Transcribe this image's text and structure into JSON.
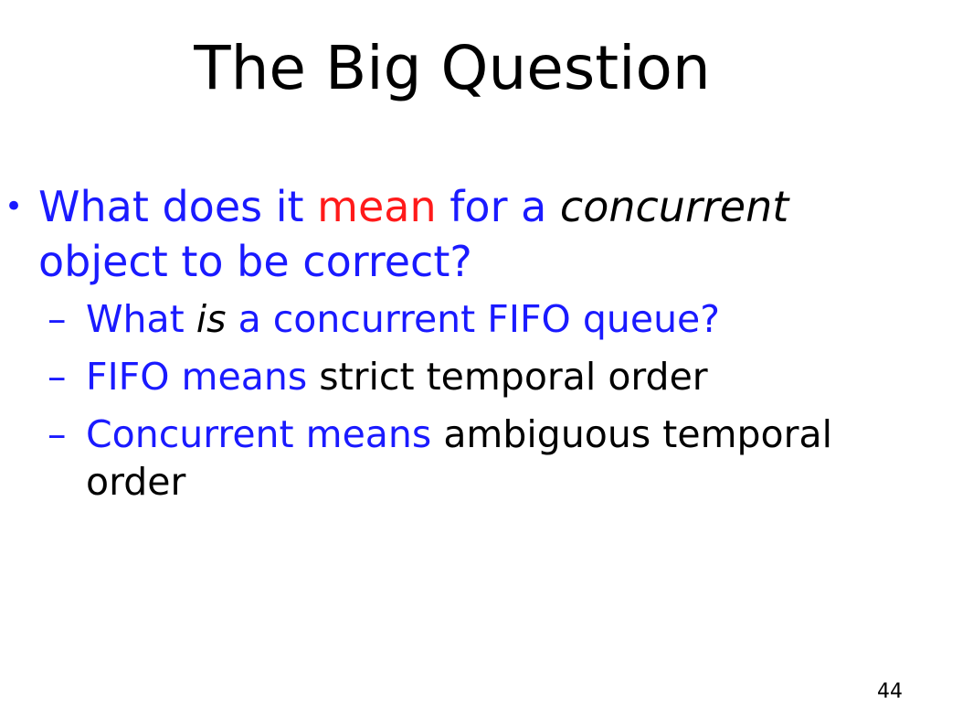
{
  "slide": {
    "title": "The Big Question",
    "bullet": {
      "dot": "•",
      "part1": "What does it ",
      "emph": "mean",
      "part2": " for a ",
      "ital": "concurrent",
      "line2": "object to be correct?"
    },
    "subbullets": [
      {
        "dash": "–",
        "a": "What ",
        "b": "is",
        "c": " a concurrent FIFO queue?"
      },
      {
        "dash": "–",
        "a": "FIFO means ",
        "b": "strict temporal order"
      },
      {
        "dash": "–",
        "a": "Concurrent means ",
        "b": "ambiguous temporal order"
      }
    ],
    "page_number": "44"
  },
  "colors": {
    "blue": "#1a1aff",
    "red": "#ff1a1a",
    "black": "#000000"
  }
}
